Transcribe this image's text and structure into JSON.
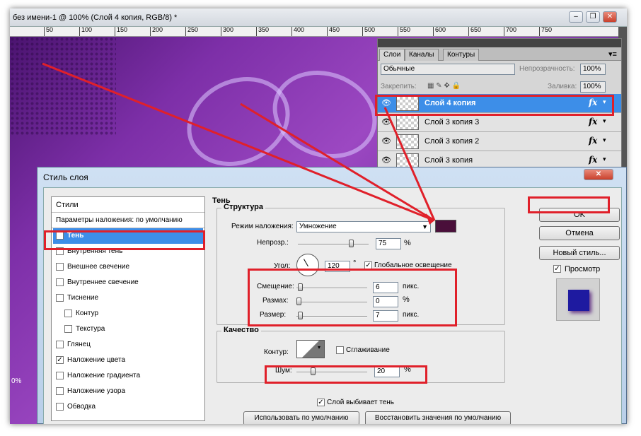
{
  "window": {
    "title": "без имени-1 @ 100% (Слой 4 копия, RGB/8) *"
  },
  "ruler": {
    "ticks": [
      "50",
      "100",
      "150",
      "200",
      "250",
      "300",
      "350",
      "400",
      "450",
      "500",
      "550",
      "600",
      "650",
      "700",
      "750"
    ]
  },
  "status": {
    "zoom": "0%"
  },
  "layers_panel": {
    "tabs": [
      "Слои",
      "Каналы",
      "Контуры"
    ],
    "blend_mode": "Обычные",
    "opacity_label": "Непрозрачность:",
    "opacity_value": "100%",
    "lock_label": "Закрепить:",
    "fill_label": "Заливка:",
    "fill_value": "100%",
    "layers": [
      {
        "name": "Слой 4 копия",
        "fx": "fx"
      },
      {
        "name": "Слой 3 копия 3",
        "fx": "fx"
      },
      {
        "name": "Слой 3 копия 2",
        "fx": "fx"
      },
      {
        "name": "Слой 3 копия",
        "fx": "fx"
      }
    ]
  },
  "dialog": {
    "title": "Стиль слоя",
    "styles_header": "Стили",
    "blend_defaults": "Параметры наложения: по умолчанию",
    "styles": [
      {
        "label": "Тень",
        "checked": "✓"
      },
      {
        "label": "Внутренняя тень",
        "checked": ""
      },
      {
        "label": "Внешнее свечение",
        "checked": ""
      },
      {
        "label": "Внутреннее свечение",
        "checked": ""
      },
      {
        "label": "Тиснение",
        "checked": ""
      },
      {
        "label": "Контур",
        "checked": ""
      },
      {
        "label": "Текстура",
        "checked": ""
      },
      {
        "label": "Глянец",
        "checked": ""
      },
      {
        "label": "Наложение цвета",
        "checked": "✓"
      },
      {
        "label": "Наложение градиента",
        "checked": ""
      },
      {
        "label": "Наложение узора",
        "checked": ""
      },
      {
        "label": "Обводка",
        "checked": ""
      }
    ],
    "section_title": "Тень",
    "structure": {
      "title": "Структура",
      "blend_mode_label": "Режим наложения:",
      "blend_mode_value": "Умножение",
      "shadow_color": "#4a0f3a",
      "opacity_label": "Непрозр.:",
      "opacity_value": "75",
      "opacity_unit": "%",
      "opacity_pct": 75,
      "angle_label": "Угол:",
      "angle_value": "120",
      "angle_unit": "°",
      "global_light_label": "Глобальное освещение",
      "global_light_checked": "✓",
      "distance_label": "Смещение:",
      "distance_value": "6",
      "distance_unit": "пикс.",
      "spread_label": "Размах:",
      "spread_value": "0",
      "spread_unit": "%",
      "size_label": "Размер:",
      "size_value": "7",
      "size_unit": "пикс."
    },
    "quality": {
      "title": "Качество",
      "contour_label": "Контур:",
      "antialias_label": "Сглаживание",
      "antialias_checked": "",
      "noise_label": "Шум:",
      "noise_value": "20",
      "noise_unit": "%"
    },
    "knockout_label": "Слой выбивает тень",
    "knockout_checked": "✓",
    "make_default": "Использовать по умолчанию",
    "reset_default": "Восстановить значения по умолчанию",
    "ok": "OK",
    "cancel": "Отмена",
    "new_style": "Новый стиль...",
    "preview_label": "Просмотр",
    "preview_checked": "✓"
  },
  "colors": {
    "highlight": "#e0202a",
    "selection": "#3d8ee8",
    "preview_square": "#1e1aa0"
  }
}
